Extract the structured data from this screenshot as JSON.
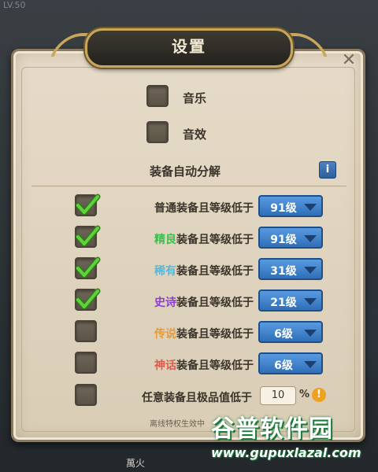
{
  "background": {
    "level_text": "LV.50",
    "bottom_text": "萬火"
  },
  "title": "设置",
  "close_icon": "close-icon",
  "toggles": [
    {
      "label": "音乐",
      "checked": false
    },
    {
      "label": "音效",
      "checked": false
    }
  ],
  "auto_decompose": {
    "section_title": "装备自动分解",
    "info_label": "i",
    "rows": [
      {
        "prefix": "普通",
        "suffix": "装备且等级低于",
        "level": "91级",
        "checked": true,
        "quality_color": "#3b342a"
      },
      {
        "prefix": "精良",
        "suffix": "装备且等级低于",
        "level": "91级",
        "checked": true,
        "quality_color": "#39c24a"
      },
      {
        "prefix": "稀有",
        "suffix": "装备且等级低于",
        "level": "31级",
        "checked": true,
        "quality_color": "#5ab6d6"
      },
      {
        "prefix": "史诗",
        "suffix": "装备且等级低于",
        "level": "21级",
        "checked": true,
        "quality_color": "#8a3fd1"
      },
      {
        "prefix": "传说",
        "suffix": "装备且等级低于",
        "level": "6级",
        "checked": false,
        "quality_color": "#e89a3a"
      },
      {
        "prefix": "神话",
        "suffix": "装备且等级低于",
        "level": "6级",
        "checked": false,
        "quality_color": "#e05a4a"
      }
    ],
    "value_row": {
      "label": "任意装备且极品值低于",
      "value": "10",
      "unit": "%",
      "warn_icon": "!",
      "checked": false
    },
    "note": "离线特权生效中"
  },
  "watermark": {
    "brand": "谷普软件园",
    "url": "www.gupuxlazal.com"
  }
}
